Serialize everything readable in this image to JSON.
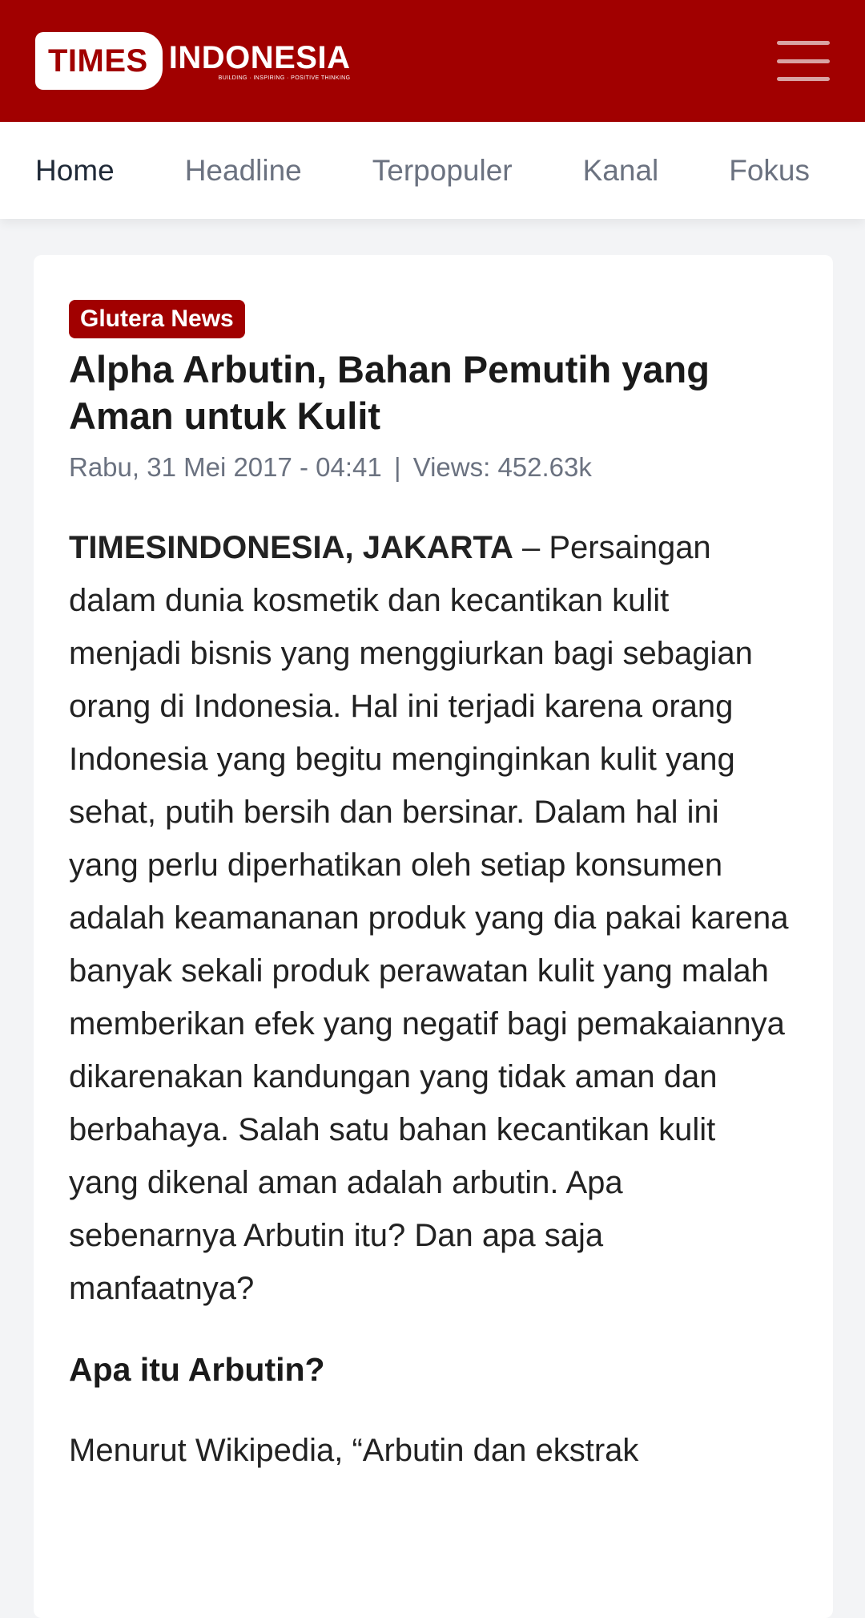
{
  "header": {
    "logo_times": "TIMES",
    "logo_indonesia": "INDONESIA",
    "logo_tagline": "BUILDING · INSPIRING · POSITIVE THINKING",
    "brand_color": "#a10000"
  },
  "nav": {
    "items": [
      {
        "label": "Home"
      },
      {
        "label": "Headline"
      },
      {
        "label": "Terpopuler"
      },
      {
        "label": "Kanal"
      },
      {
        "label": "Fokus"
      }
    ]
  },
  "article": {
    "category": "Glutera News",
    "title": "Alpha Arbutin, Bahan Pemutih yang Aman untuk Kulit",
    "date": "Rabu, 31 Mei 2017 - 04:41",
    "meta_separator": "|",
    "views": "Views: 452.63k",
    "dateline": "TIMESINDONESIA, JAKARTA",
    "lead": " – Persaingan dalam dunia kosmetik dan kecantikan kulit menjadi bisnis yang menggiurkan bagi sebagian orang di Indonesia. Hal ini terjadi karena orang Indonesia yang begitu menginginkan kulit yang sehat, putih bersih dan bersinar. Dalam hal ini yang perlu diperhatikan oleh setiap konsumen adalah keamananan produk yang dia pakai karena banyak sekali produk perawatan kulit yang malah memberikan efek yang negatif bagi pemakaiannya dikarenakan kandungan yang tidak aman dan berbahaya. Salah satu bahan kecantikan kulit yang dikenal aman adalah arbutin. Apa sebenarnya Arbutin itu? Dan apa saja manfaatnya?",
    "subheading": "Apa itu Arbutin?",
    "next_paragraph": "Menurut Wikipedia, “Arbutin dan ekstrak"
  }
}
